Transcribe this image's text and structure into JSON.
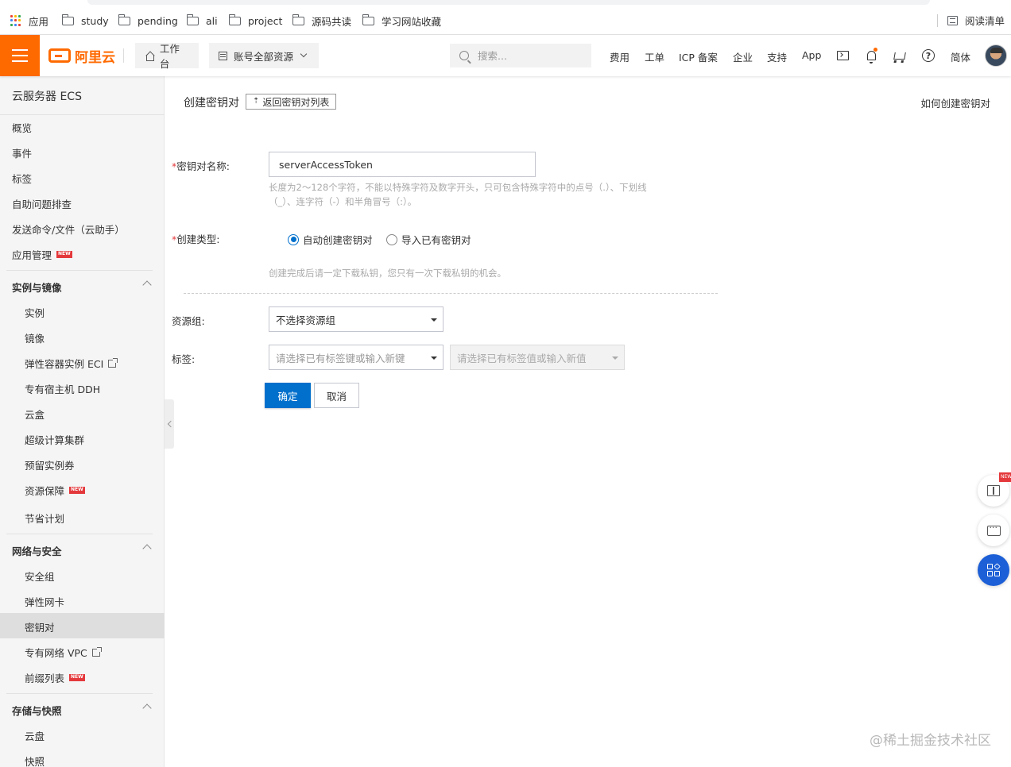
{
  "bookmarks": {
    "apps": "应用",
    "items": [
      "study",
      "pending",
      "ali",
      "project",
      "源码共读",
      "学习网站收藏"
    ],
    "reading_list": "阅读清单"
  },
  "topnav": {
    "logo": "阿里云",
    "workbench": "工作台",
    "resources": "账号全部资源",
    "search_placeholder": "搜索...",
    "links": [
      "费用",
      "工单",
      "ICP 备案",
      "企业",
      "支持",
      "App"
    ],
    "lang": "简体"
  },
  "sidebar": {
    "title": "云服务器 ECS",
    "top_items": [
      "概览",
      "事件",
      "标签",
      "自助问题排查",
      "发送命令/文件（云助手）",
      "应用管理"
    ],
    "new_badge": "NEW",
    "groups": [
      {
        "label": "实例与镜像",
        "items": [
          "实例",
          "镜像",
          "弹性容器实例 ECI",
          "专有宿主机 DDH",
          "云盒",
          "超级计算集群",
          "预留实例券",
          "资源保障",
          "节省计划"
        ]
      },
      {
        "label": "网络与安全",
        "items": [
          "安全组",
          "弹性网卡",
          "密钥对",
          "专有网络 VPC",
          "前缀列表"
        ]
      },
      {
        "label": "存储与快照",
        "items": [
          "云盘",
          "快照"
        ]
      }
    ],
    "active_item": "密钥对"
  },
  "main": {
    "title": "创建密钥对",
    "back_button": "返回密钥对列表",
    "help_link": "如何创建密钥对",
    "name_field": {
      "required_mark": "*",
      "label": "密钥对名称:",
      "value": "serverAccessToken",
      "hint_line1": "长度为2～128个字符，不能以特殊字符及数字开头，只可包含特殊字符中的点号（.）、下划线",
      "hint_line2": "（_）、连字符（-）和半角冒号（:）。"
    },
    "type_field": {
      "required_mark": "*",
      "label": "创建类型:",
      "option_auto": "自动创建密钥对",
      "option_import": "导入已有密钥对",
      "selected": "自动创建密钥对",
      "hint": "创建完成后请一定下载私钥，您只有一次下载私钥的机会。"
    },
    "resource_group": {
      "label": "资源组:",
      "value": "不选择资源组"
    },
    "tags": {
      "label": "标签:",
      "key_placeholder": "请选择已有标签键或输入新键",
      "value_placeholder": "请选择已有标签值或输入新值"
    },
    "confirm_button": "确定",
    "cancel_button": "取消"
  },
  "floating": {
    "badge": "NEW"
  },
  "watermark": "@稀土掘金技术社区",
  "colors": {
    "brand": "#ff6a00",
    "primary": "#0070cc",
    "required": "#e4393c"
  }
}
